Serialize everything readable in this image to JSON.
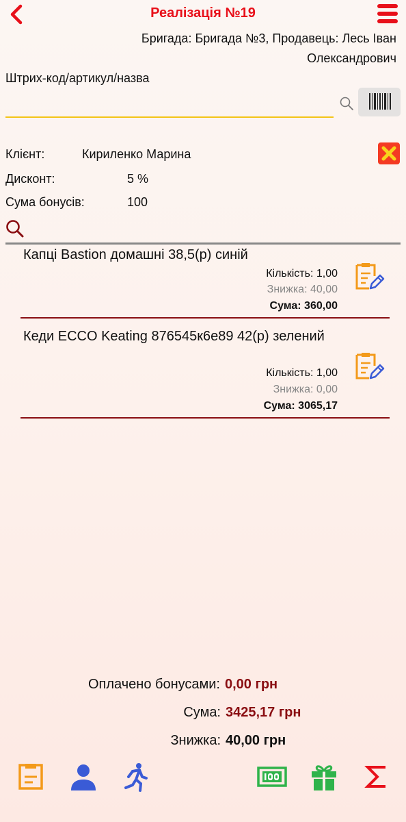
{
  "header": {
    "title": "Реалізація №19",
    "brigade_line1": "Бригада: Бригада №3, Продавець: Лесь Іван",
    "brigade_line2": "Олександрович"
  },
  "search": {
    "label": "Штрих-код/артикул/назва",
    "value": ""
  },
  "client": {
    "client_label": "Клієнт:",
    "client_value": "Кириленко Марина",
    "discount_label": "Дисконт:",
    "discount_value": "5 %",
    "bonus_label": "Сума бонусів:",
    "bonus_value": "100"
  },
  "items": [
    {
      "name": "Капці Bastion домашні 38,5(р) синій",
      "qty": "Кількість: 1,00",
      "discount": "Знижка: 40,00",
      "sum": "Сума: 360,00"
    },
    {
      "name": "Кеди ECCO Keating 876545к6е89 42(р) зелений",
      "qty": "Кількість: 1,00",
      "discount": "Знижка: 0,00",
      "sum": "Сума: 3065,17"
    }
  ],
  "totals": {
    "paid_bonus_label": "Оплачено бонусами:",
    "paid_bonus_value": "0,00 грн",
    "sum_label": "Сума:",
    "sum_value": "3425,17 грн",
    "discount_label": "Знижка:",
    "discount_value": "40,00 грн"
  },
  "colors": {
    "accent_red": "#e8101a",
    "dark_red": "#8a0e12",
    "orange": "#f39a1a",
    "blue": "#3a5bd6",
    "green": "#2fb34a"
  },
  "toolbar": {
    "icons": [
      "save-doc-icon",
      "client-icon",
      "run-icon",
      "cash-icon",
      "gift-icon",
      "sigma-icon"
    ]
  }
}
